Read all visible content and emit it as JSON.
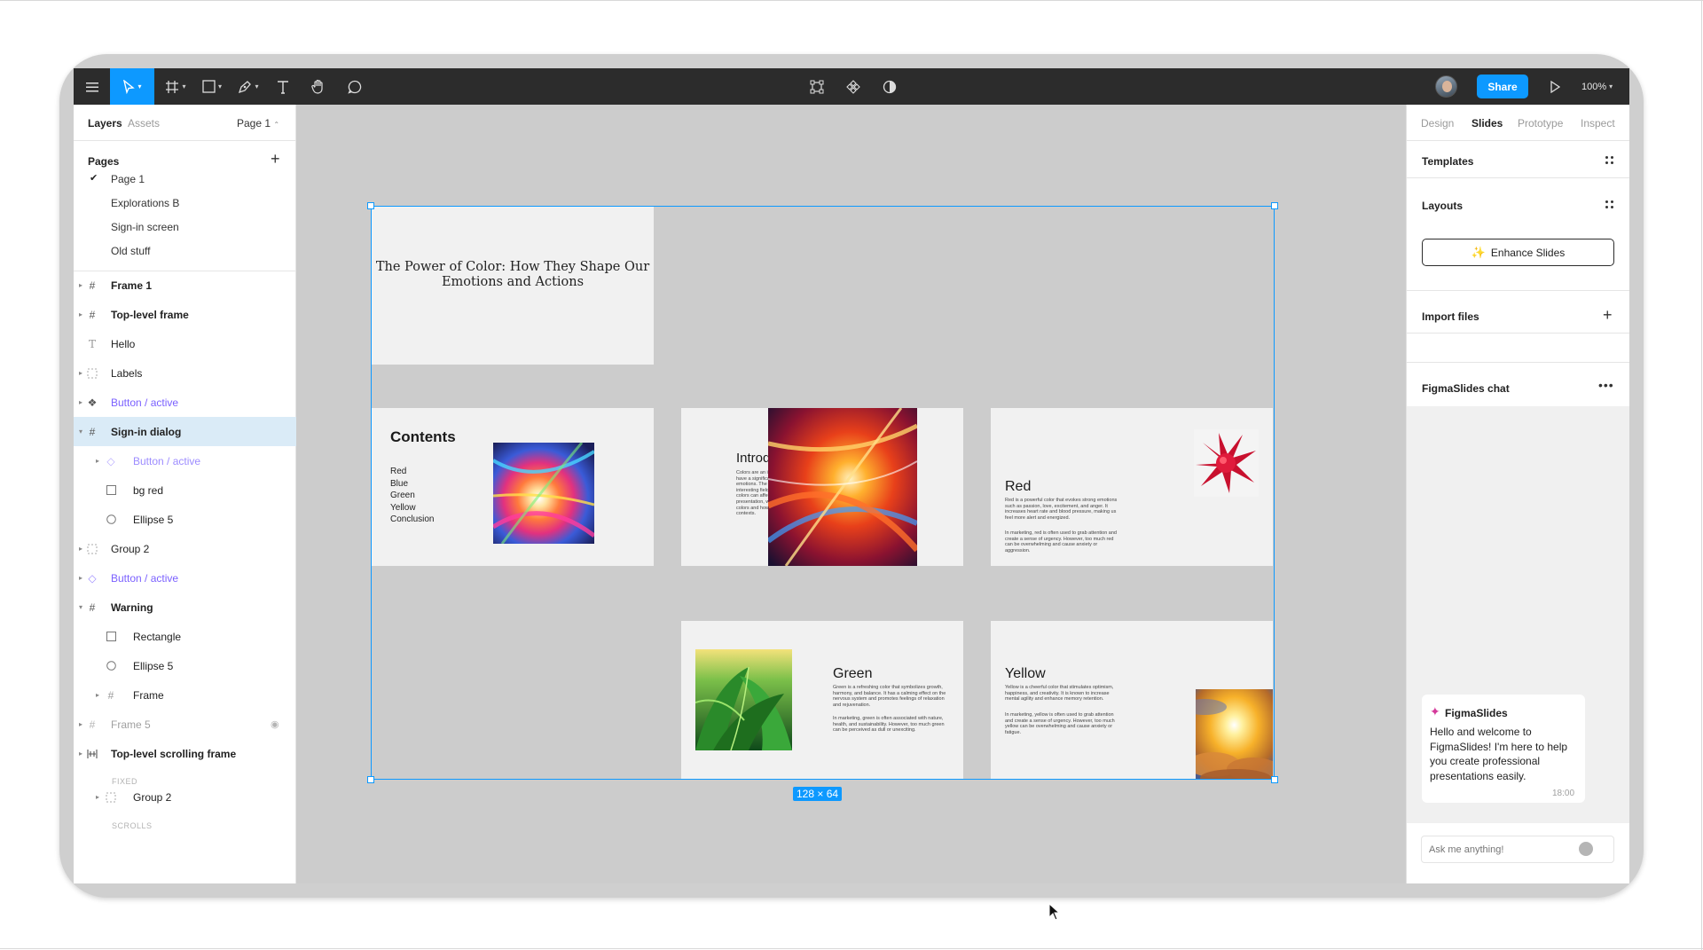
{
  "toolbar": {
    "zoom_label": "100%",
    "share_label": "Share",
    "icons": [
      "menu-icon",
      "move-icon",
      "frame-icon",
      "rectangle-icon",
      "pen-icon",
      "text-icon",
      "hand-icon",
      "comment-icon",
      "dev-mode-icon",
      "components-icon",
      "theme-icon",
      "play-icon"
    ],
    "accent_color": "#0d99ff"
  },
  "left_panel": {
    "tabs": [
      "Layers",
      "Assets"
    ],
    "page_selector": "Page 1",
    "pages_title": "Pages",
    "pages": [
      "Page 1",
      "Explorations B",
      "Sign-in screen",
      "Old stuff"
    ],
    "layers": [
      {
        "name": "Frame 1"
      },
      {
        "name": "Top-level frame"
      },
      {
        "name": "Hello"
      },
      {
        "name": "Labels"
      },
      {
        "name": "Button / active"
      },
      {
        "name": "Sign-in dialog"
      },
      {
        "name": "Button / active"
      },
      {
        "name": "bg red"
      },
      {
        "name": "Ellipse 5"
      },
      {
        "name": "Group 2"
      },
      {
        "name": "Button / active"
      },
      {
        "name": "Warning"
      },
      {
        "name": "Rectangle"
      },
      {
        "name": "Ellipse 5"
      },
      {
        "name": "Frame"
      },
      {
        "name": "Frame 5"
      },
      {
        "name": "Top-level scrolling frame"
      },
      {
        "name": "Group 2"
      }
    ],
    "section_fixed": "FIXED",
    "section_scrolls": "SCROLLS"
  },
  "canvas": {
    "title_slide": "The Power of Color: How They Shape Our Emotions and Actions",
    "contents_heading": "Contents",
    "contents_items": [
      "Red",
      "Blue",
      "Green",
      "Yellow",
      "Conclusion"
    ],
    "intro_heading": "Introduction",
    "intro_body": "Colors are an integral part of our lives, and they have a significant impact on our behavior and emotions. The psychology of colors is an interesting field that explores how different colors can affect our mood and actions. In this presentation, we will explore the meaning of colors and how they influence us in various contexts.",
    "red_heading": "Red",
    "red_body_1": "Red is a powerful color that evokes strong emotions such as passion, love, excitement, and anger. It increases heart rate and blood pressure, making us feel more alert and energized.",
    "red_body_2": "In marketing, red is often used to grab attention and create a sense of urgency. However, too much red can be overwhelming and cause anxiety or aggression.",
    "green_heading": "Green",
    "green_body_1": "Green is a refreshing color that symbolizes growth, harmony, and balance. It has a calming effect on the nervous system and promotes feelings of relaxation and rejuvenation.",
    "green_body_2": "In marketing, green is often associated with nature, health, and sustainability. However, too much green can be perceived as dull or unexciting.",
    "yellow_heading": "Yellow",
    "yellow_body_1": "Yellow is a cheerful color that stimulates optimism, happiness, and creativity. It is known to increase mental agility and enhance memory retention.",
    "yellow_body_2": "In marketing, yellow is often used to grab attention and create a sense of urgency. However, too much yellow can be overwhelming and cause anxiety or fatigue.",
    "selection_size": "128 × 64"
  },
  "right_panel": {
    "tabs": [
      "Design",
      "Slides",
      "Prototype",
      "Inspect"
    ],
    "active_tab": "Slides",
    "templates_label": "Templates",
    "layouts_label": "Layouts",
    "enhance_label": "Enhance Slides",
    "import_label": "Import files",
    "chat_label": "FigmaSlides chat",
    "chat_sender": "FigmaSlides",
    "chat_message": "Hello and welcome to FigmaSlides! I'm here to help you create professional presentations easily.",
    "chat_time": "18:00",
    "chat_placeholder": "Ask me anything!"
  }
}
